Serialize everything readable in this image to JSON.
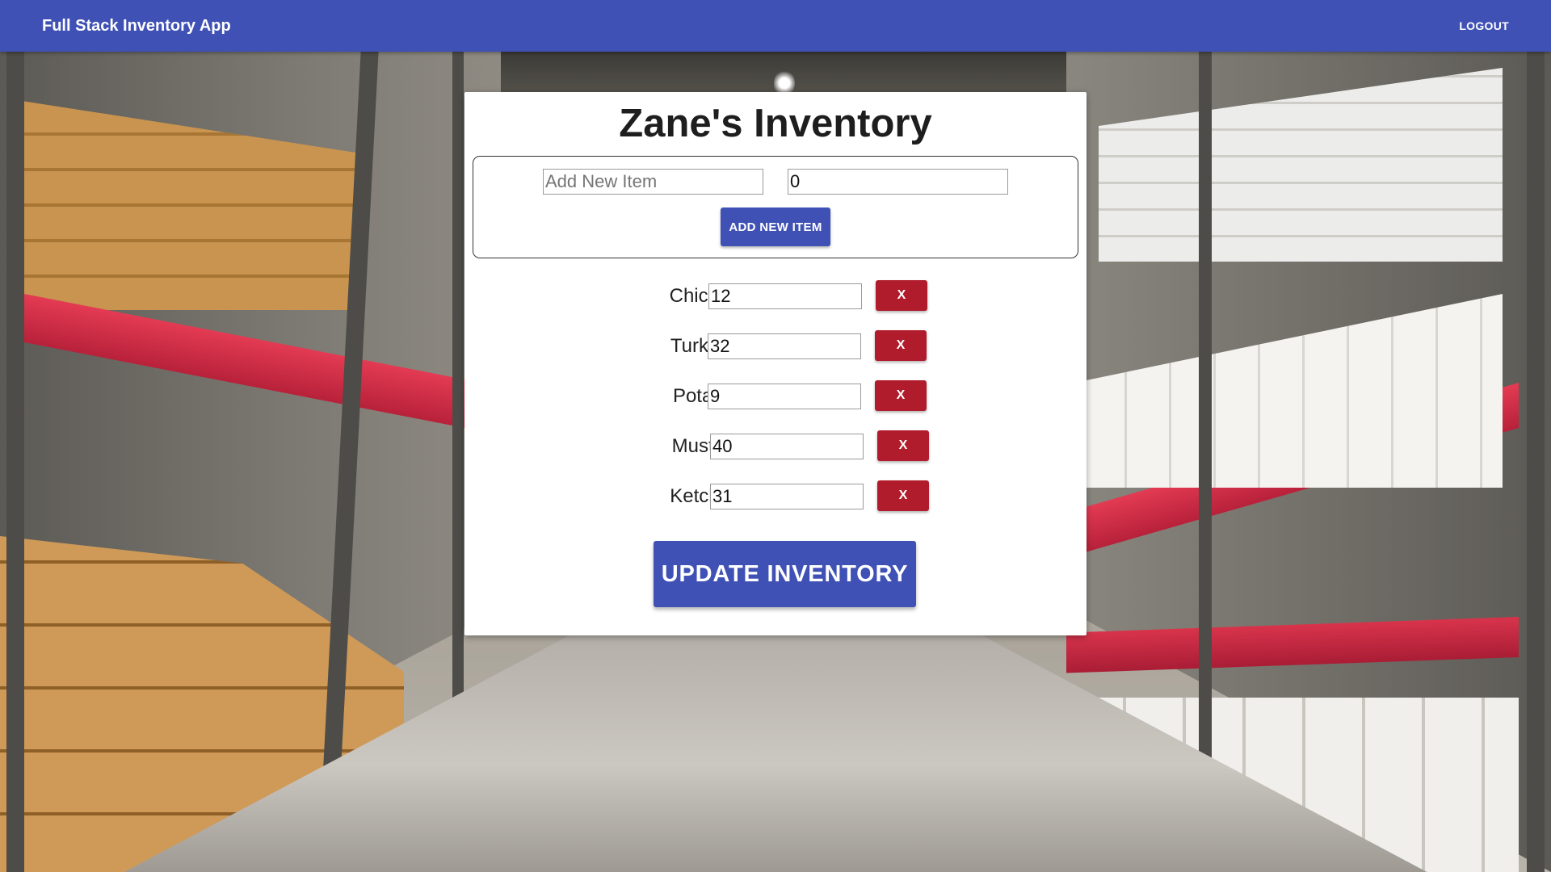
{
  "appbar": {
    "brand": "Full Stack Inventory App",
    "logout_label": "LOGOUT",
    "color": "#3f51b5"
  },
  "card": {
    "title": "Zane's Inventory"
  },
  "add_form": {
    "name_placeholder": "Add New Item",
    "name_value": "",
    "quantity_value": "0",
    "add_button_label": "ADD NEW ITEM"
  },
  "items": [
    {
      "label": "Chicken:",
      "quantity": "12",
      "delete_label": "X"
    },
    {
      "label": "Turkeys:",
      "quantity": "32",
      "delete_label": "X"
    },
    {
      "label": "Potatos:",
      "quantity": "9",
      "delete_label": "X"
    },
    {
      "label": "Mustard:",
      "quantity": "40",
      "delete_label": "X"
    },
    {
      "label": "Ketchup:",
      "quantity": "31",
      "delete_label": "X"
    }
  ],
  "update_button_label": "UPDATE INVENTORY",
  "colors": {
    "primary": "#3f51b5",
    "danger": "#b01c2b"
  },
  "background": "warehouse-aisle-photo"
}
